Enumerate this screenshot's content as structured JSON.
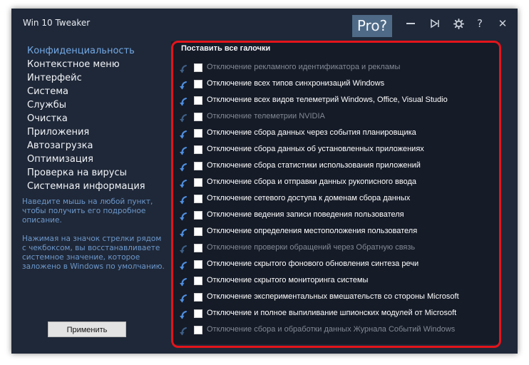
{
  "app": {
    "title": "Win 10 Tweaker",
    "pro_label": "Pro?"
  },
  "titlebar_buttons": [
    {
      "name": "minimize-icon"
    },
    {
      "name": "play-icon"
    },
    {
      "name": "gear-icon"
    },
    {
      "name": "help-icon",
      "glyph": "?"
    },
    {
      "name": "close-icon",
      "glyph": "✕"
    }
  ],
  "sidebar": {
    "items": [
      {
        "label": "Конфиденциальность",
        "active": true
      },
      {
        "label": "Контекстное меню"
      },
      {
        "label": "Интерфейс"
      },
      {
        "label": "Система"
      },
      {
        "label": "Службы"
      },
      {
        "label": "Очистка"
      },
      {
        "label": "Приложения"
      },
      {
        "label": "Автозагрузка"
      },
      {
        "label": "Оптимизация"
      },
      {
        "label": "Проверка на вирусы"
      },
      {
        "label": "Системная информация"
      }
    ],
    "hint1": "Наведите мышь на любой пункт, чтобы получить его подробное описание.",
    "hint2": "Нажимая на значок стрелки рядом с чекбоксом, вы восстанавливаете системное значение, которое заложено в Windows по умолчанию.",
    "apply_label": "Применить"
  },
  "main": {
    "select_all_label": "Поставить все галочки",
    "options": [
      {
        "label": "Отключение рекламного идентификатора и рекламы",
        "disabled": true,
        "checked": false
      },
      {
        "label": "Отключение всех типов синхронизаций Windows",
        "disabled": false,
        "checked": false
      },
      {
        "label": "Отключение всех видов телеметрий Windows, Office, Visual Studio",
        "disabled": false,
        "checked": false
      },
      {
        "label": "Отключение телеметрии NVIDIA",
        "disabled": true,
        "checked": false
      },
      {
        "label": "Отключение сбора данных через события планировщика",
        "disabled": false,
        "checked": false
      },
      {
        "label": "Отключение сбора данных об установленных приложениях",
        "disabled": false,
        "checked": false
      },
      {
        "label": "Отключение сбора статистики использования приложений",
        "disabled": false,
        "checked": false
      },
      {
        "label": "Отключение сбора и отправки данных рукописного ввода",
        "disabled": false,
        "checked": false
      },
      {
        "label": "Отключение сетевого доступа к доменам сбора данных",
        "disabled": false,
        "checked": false
      },
      {
        "label": "Отключение ведения записи поведения пользователя",
        "disabled": false,
        "checked": false
      },
      {
        "label": "Отключение определения местоположения пользователя",
        "disabled": false,
        "checked": false
      },
      {
        "label": "Отключение проверки обращений через Обратную связь",
        "disabled": true,
        "checked": false
      },
      {
        "label": "Отключение скрытого фонового обновления синтеза речи",
        "disabled": false,
        "checked": false
      },
      {
        "label": "Отключение скрытого мониторинга системы",
        "disabled": false,
        "checked": false
      },
      {
        "label": "Отключение экспериментальных вмешательств со стороны Microsoft",
        "disabled": false,
        "checked": false
      },
      {
        "label": "Отключение и полное выпиливание шпионских модулей от Microsoft",
        "disabled": false,
        "checked": false
      },
      {
        "label": "Отключение сбора и обработки данных Журнала Событий Windows",
        "disabled": true,
        "checked": false
      }
    ]
  },
  "colors": {
    "window_bg": "#1f2838",
    "panel_bg": "#151b27",
    "accent": "#73a9e6",
    "highlight_border": "#e3141b",
    "restore_arrow_active": "#4f8fe0",
    "restore_arrow_disabled": "#3e5f86"
  }
}
